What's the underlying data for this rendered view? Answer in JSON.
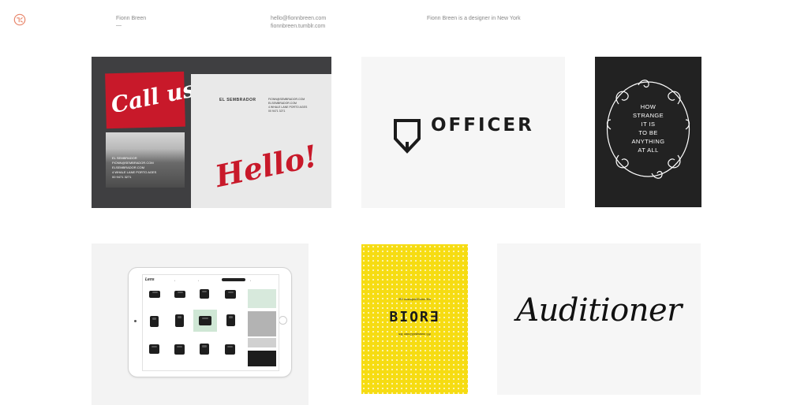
{
  "header": {
    "name": "Fionn Breen",
    "name_dash": "—",
    "email": "hello@fionnbreen.com",
    "tumblr": "fionnbreen.tumblr.com",
    "tagline": "Fionn Breen is a designer in New York"
  },
  "colors": {
    "logo": "#e8856a",
    "red": "#c8192a",
    "yellow": "#f6dc12",
    "dark": "#222222"
  },
  "projects": [
    {
      "id": "el-sembrador",
      "card_script": "Call us!",
      "card_brand": "EL SEMBRADOR",
      "card_contact": "FIONN@SEMBRADOR.COM",
      "card_site": "ELSEMBRADOR.COM",
      "card_address": "4 WHALE LANE PORTO AGES",
      "card_phone": "00 9471 3271",
      "paper_brand": "EL SEMBRADOR",
      "paper_line1": "FIONN@SEMBRADOR.COM",
      "paper_line2": "ELSEMBRADOR.COM",
      "paper_line3": "4 WHALE LANE PORTO AGES",
      "paper_line4": "00 9471 3271",
      "paper_script": "Hello!"
    },
    {
      "id": "officer",
      "wordmark": "OFFICER",
      "icon": "shield-icon"
    },
    {
      "id": "how-strange",
      "lines": [
        "HOW",
        "STRANGE",
        "IT IS",
        "TO BE",
        "ANYTHING",
        "AT ALL"
      ]
    },
    {
      "id": "ipad-shop",
      "brand": "Lens",
      "nav": [
        "•",
        "•",
        "•"
      ]
    },
    {
      "id": "yellow-poster",
      "top_text": "/fl3 ouaaqsd32alan 3fa",
      "wordmark": "BIOR∃",
      "bottom_text": "/fl3 ouaaqsd32alan 3fa"
    },
    {
      "id": "auditioner",
      "script": "Auditioner"
    }
  ]
}
